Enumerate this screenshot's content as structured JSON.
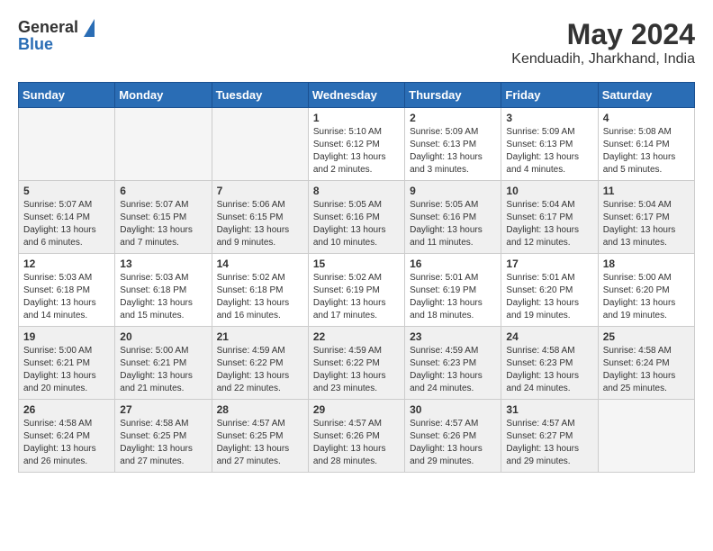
{
  "logo": {
    "general": "General",
    "blue": "Blue"
  },
  "title": {
    "month_year": "May 2024",
    "location": "Kenduadih, Jharkhand, India"
  },
  "days_header": [
    "Sunday",
    "Monday",
    "Tuesday",
    "Wednesday",
    "Thursday",
    "Friday",
    "Saturday"
  ],
  "weeks": [
    [
      {
        "day": "",
        "sunrise": "",
        "sunset": "",
        "daylight": ""
      },
      {
        "day": "",
        "sunrise": "",
        "sunset": "",
        "daylight": ""
      },
      {
        "day": "",
        "sunrise": "",
        "sunset": "",
        "daylight": ""
      },
      {
        "day": "1",
        "sunrise": "Sunrise: 5:10 AM",
        "sunset": "Sunset: 6:12 PM",
        "daylight": "Daylight: 13 hours and 2 minutes."
      },
      {
        "day": "2",
        "sunrise": "Sunrise: 5:09 AM",
        "sunset": "Sunset: 6:13 PM",
        "daylight": "Daylight: 13 hours and 3 minutes."
      },
      {
        "day": "3",
        "sunrise": "Sunrise: 5:09 AM",
        "sunset": "Sunset: 6:13 PM",
        "daylight": "Daylight: 13 hours and 4 minutes."
      },
      {
        "day": "4",
        "sunrise": "Sunrise: 5:08 AM",
        "sunset": "Sunset: 6:14 PM",
        "daylight": "Daylight: 13 hours and 5 minutes."
      }
    ],
    [
      {
        "day": "5",
        "sunrise": "Sunrise: 5:07 AM",
        "sunset": "Sunset: 6:14 PM",
        "daylight": "Daylight: 13 hours and 6 minutes."
      },
      {
        "day": "6",
        "sunrise": "Sunrise: 5:07 AM",
        "sunset": "Sunset: 6:15 PM",
        "daylight": "Daylight: 13 hours and 7 minutes."
      },
      {
        "day": "7",
        "sunrise": "Sunrise: 5:06 AM",
        "sunset": "Sunset: 6:15 PM",
        "daylight": "Daylight: 13 hours and 9 minutes."
      },
      {
        "day": "8",
        "sunrise": "Sunrise: 5:05 AM",
        "sunset": "Sunset: 6:16 PM",
        "daylight": "Daylight: 13 hours and 10 minutes."
      },
      {
        "day": "9",
        "sunrise": "Sunrise: 5:05 AM",
        "sunset": "Sunset: 6:16 PM",
        "daylight": "Daylight: 13 hours and 11 minutes."
      },
      {
        "day": "10",
        "sunrise": "Sunrise: 5:04 AM",
        "sunset": "Sunset: 6:17 PM",
        "daylight": "Daylight: 13 hours and 12 minutes."
      },
      {
        "day": "11",
        "sunrise": "Sunrise: 5:04 AM",
        "sunset": "Sunset: 6:17 PM",
        "daylight": "Daylight: 13 hours and 13 minutes."
      }
    ],
    [
      {
        "day": "12",
        "sunrise": "Sunrise: 5:03 AM",
        "sunset": "Sunset: 6:18 PM",
        "daylight": "Daylight: 13 hours and 14 minutes."
      },
      {
        "day": "13",
        "sunrise": "Sunrise: 5:03 AM",
        "sunset": "Sunset: 6:18 PM",
        "daylight": "Daylight: 13 hours and 15 minutes."
      },
      {
        "day": "14",
        "sunrise": "Sunrise: 5:02 AM",
        "sunset": "Sunset: 6:18 PM",
        "daylight": "Daylight: 13 hours and 16 minutes."
      },
      {
        "day": "15",
        "sunrise": "Sunrise: 5:02 AM",
        "sunset": "Sunset: 6:19 PM",
        "daylight": "Daylight: 13 hours and 17 minutes."
      },
      {
        "day": "16",
        "sunrise": "Sunrise: 5:01 AM",
        "sunset": "Sunset: 6:19 PM",
        "daylight": "Daylight: 13 hours and 18 minutes."
      },
      {
        "day": "17",
        "sunrise": "Sunrise: 5:01 AM",
        "sunset": "Sunset: 6:20 PM",
        "daylight": "Daylight: 13 hours and 19 minutes."
      },
      {
        "day": "18",
        "sunrise": "Sunrise: 5:00 AM",
        "sunset": "Sunset: 6:20 PM",
        "daylight": "Daylight: 13 hours and 19 minutes."
      }
    ],
    [
      {
        "day": "19",
        "sunrise": "Sunrise: 5:00 AM",
        "sunset": "Sunset: 6:21 PM",
        "daylight": "Daylight: 13 hours and 20 minutes."
      },
      {
        "day": "20",
        "sunrise": "Sunrise: 5:00 AM",
        "sunset": "Sunset: 6:21 PM",
        "daylight": "Daylight: 13 hours and 21 minutes."
      },
      {
        "day": "21",
        "sunrise": "Sunrise: 4:59 AM",
        "sunset": "Sunset: 6:22 PM",
        "daylight": "Daylight: 13 hours and 22 minutes."
      },
      {
        "day": "22",
        "sunrise": "Sunrise: 4:59 AM",
        "sunset": "Sunset: 6:22 PM",
        "daylight": "Daylight: 13 hours and 23 minutes."
      },
      {
        "day": "23",
        "sunrise": "Sunrise: 4:59 AM",
        "sunset": "Sunset: 6:23 PM",
        "daylight": "Daylight: 13 hours and 24 minutes."
      },
      {
        "day": "24",
        "sunrise": "Sunrise: 4:58 AM",
        "sunset": "Sunset: 6:23 PM",
        "daylight": "Daylight: 13 hours and 24 minutes."
      },
      {
        "day": "25",
        "sunrise": "Sunrise: 4:58 AM",
        "sunset": "Sunset: 6:24 PM",
        "daylight": "Daylight: 13 hours and 25 minutes."
      }
    ],
    [
      {
        "day": "26",
        "sunrise": "Sunrise: 4:58 AM",
        "sunset": "Sunset: 6:24 PM",
        "daylight": "Daylight: 13 hours and 26 minutes."
      },
      {
        "day": "27",
        "sunrise": "Sunrise: 4:58 AM",
        "sunset": "Sunset: 6:25 PM",
        "daylight": "Daylight: 13 hours and 27 minutes."
      },
      {
        "day": "28",
        "sunrise": "Sunrise: 4:57 AM",
        "sunset": "Sunset: 6:25 PM",
        "daylight": "Daylight: 13 hours and 27 minutes."
      },
      {
        "day": "29",
        "sunrise": "Sunrise: 4:57 AM",
        "sunset": "Sunset: 6:26 PM",
        "daylight": "Daylight: 13 hours and 28 minutes."
      },
      {
        "day": "30",
        "sunrise": "Sunrise: 4:57 AM",
        "sunset": "Sunset: 6:26 PM",
        "daylight": "Daylight: 13 hours and 29 minutes."
      },
      {
        "day": "31",
        "sunrise": "Sunrise: 4:57 AM",
        "sunset": "Sunset: 6:27 PM",
        "daylight": "Daylight: 13 hours and 29 minutes."
      },
      {
        "day": "",
        "sunrise": "",
        "sunset": "",
        "daylight": ""
      }
    ]
  ]
}
